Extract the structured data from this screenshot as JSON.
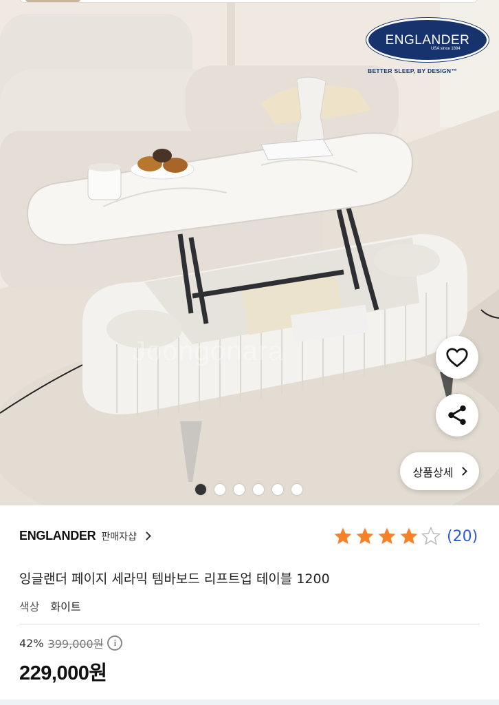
{
  "hero": {
    "brand_logo": {
      "name": "ENGLANDER",
      "sub": "USA since 1894",
      "tagline": "BETTER SLEEP, BY DESIGN™"
    },
    "watermark": "Joongonara",
    "carousel": {
      "total": 6,
      "active": 0
    },
    "heart_icon": "heart-outline-icon",
    "share_icon": "share-icon",
    "detail_button": "상품상세"
  },
  "seller": {
    "name": "ENGLANDER",
    "link_label": "판매자샵"
  },
  "rating": {
    "stars": 4,
    "max": 5,
    "count_label": "(20)",
    "star_color": "#f5822a",
    "count_color": "#2a5bd7"
  },
  "product": {
    "title": "잉글랜더 페이지 세라믹 템바보드 리프트업 테이블 1200",
    "option_label": "색상",
    "option_value": "화이트"
  },
  "pricing": {
    "discount": "42%",
    "original": "399,000원",
    "price": "229,000원"
  }
}
